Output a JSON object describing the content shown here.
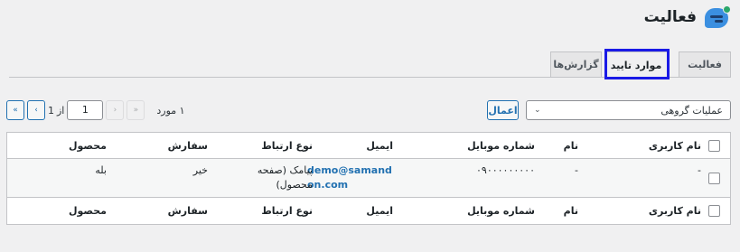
{
  "header": {
    "title": "فعالیت",
    "logo_icon": "chat-bubble-icon"
  },
  "tabs": [
    {
      "label": "فعالیت",
      "active": false
    },
    {
      "label": "موارد تایید",
      "active": true
    },
    {
      "label": "گزارش‌ها",
      "active": false
    }
  ],
  "bulk_actions": {
    "selected": "عملیات گروهی",
    "apply_label": "اعمال"
  },
  "pagination": {
    "items_count": "۱ مورد",
    "first": "«",
    "prev": "‹",
    "next": "›",
    "last": "»",
    "current_page": "1",
    "of_label": "از",
    "total_pages": "1"
  },
  "table": {
    "columns": {
      "username": "نام کاربری",
      "name": "نام",
      "mobile": "شماره موبایل",
      "email": "ایمیل",
      "contact_type": "نوع ارتباط",
      "order": "سفارش",
      "product": "محصول"
    },
    "rows": [
      {
        "username": "-",
        "name": "-",
        "mobile": "۰۹۰۰۰۰۰۰۰۰۰",
        "email": "demo@samandon.com",
        "contact_type": "پیامک (صفحه محصول)",
        "order": "خیر",
        "product": "بله"
      }
    ]
  },
  "colors": {
    "accent": "#2271b1",
    "highlight": "#1a1ae6"
  }
}
